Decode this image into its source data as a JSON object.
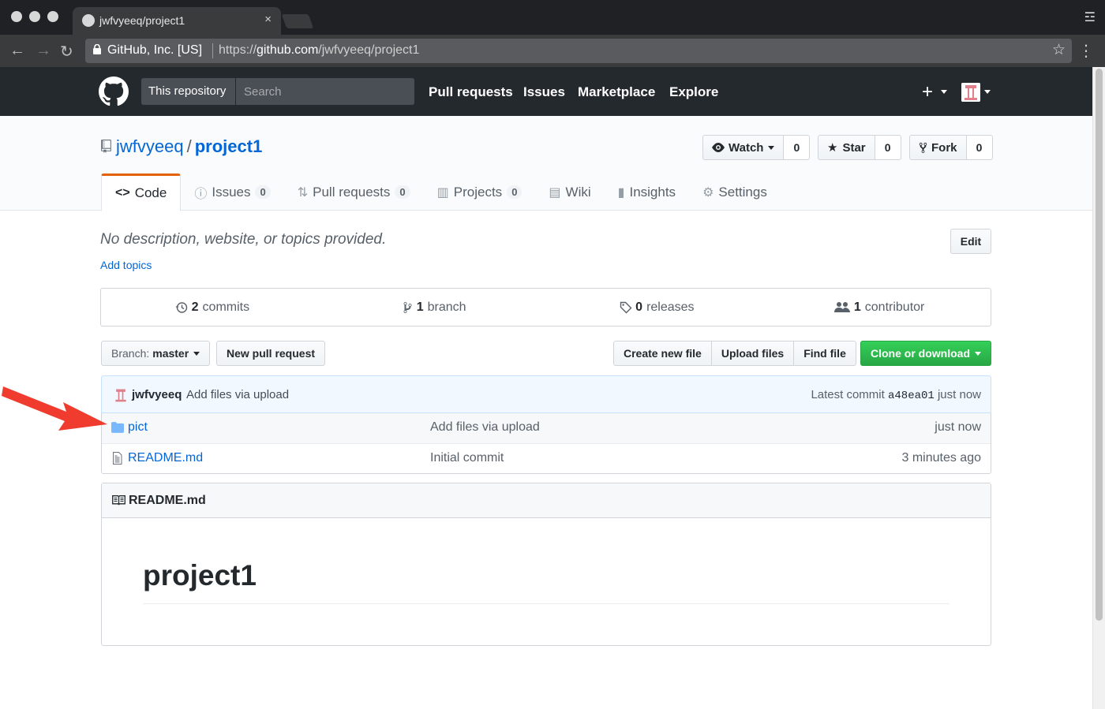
{
  "browser": {
    "tab_title": "jwfvyeeq/project1",
    "tab_close": "×",
    "org_label": "GitHub, Inc. [US]",
    "url_scheme": "https://",
    "url_host": "github.com",
    "url_path": "/jwfvyeeq/project1",
    "back_glyph": "←",
    "forward_glyph": "→",
    "reload_glyph": "↻",
    "star_glyph": "☆",
    "menu_glyph": "⋮",
    "ext_glyph": "☲"
  },
  "header": {
    "search_scope": "This repository",
    "search_placeholder": "Search",
    "nav": [
      "Pull requests",
      "Issues",
      "Marketplace",
      "Explore"
    ],
    "plus_glyph": "+"
  },
  "repo": {
    "owner": "jwfvyeeq",
    "separator": "/",
    "name": "project1",
    "watch_label": "Watch",
    "watch_count": "0",
    "star_label": "Star",
    "star_count": "0",
    "fork_label": "Fork",
    "fork_count": "0",
    "tabs": [
      {
        "label": "Code",
        "icon": "<>",
        "count": null
      },
      {
        "label": "Issues",
        "icon": "ⓘ",
        "count": "0"
      },
      {
        "label": "Pull requests",
        "icon": "⇅",
        "count": "0"
      },
      {
        "label": "Projects",
        "icon": "▥",
        "count": "0"
      },
      {
        "label": "Wiki",
        "icon": "▤",
        "count": null
      },
      {
        "label": "Insights",
        "icon": "▮",
        "count": null
      },
      {
        "label": "Settings",
        "icon": "⚙",
        "count": null
      }
    ]
  },
  "content": {
    "description": "No description, website, or topics provided.",
    "add_topics": "Add topics",
    "edit_label": "Edit",
    "summary": {
      "commits_num": "2",
      "commits_label": "commits",
      "branch_num": "1",
      "branch_label": "branch",
      "releases_num": "0",
      "releases_label": "releases",
      "contributor_num": "1",
      "contributor_label": "contributor"
    },
    "branch_label": "Branch:",
    "branch_name": "master",
    "new_pr_label": "New pull request",
    "create_file_label": "Create new file",
    "upload_label": "Upload files",
    "find_label": "Find file",
    "clone_label": "Clone or download",
    "commit": {
      "author": "jwfvyeeq",
      "message": "Add files via upload",
      "latest_label": "Latest commit",
      "sha": "a48ea01",
      "time": "just now"
    },
    "files": [
      {
        "name": "pict",
        "type": "folder",
        "message": "Add files via upload",
        "age": "just now"
      },
      {
        "name": "README.md",
        "type": "file",
        "message": "Initial commit",
        "age": "3 minutes ago"
      }
    ],
    "readme": {
      "filename": "README.md",
      "heading": "project1"
    }
  },
  "colors": {
    "header_bg": "#24292e",
    "link": "#0366d6",
    "accent_tab": "#e36209",
    "clone_green": "#28a745",
    "arrow_red": "#f03c2e"
  }
}
